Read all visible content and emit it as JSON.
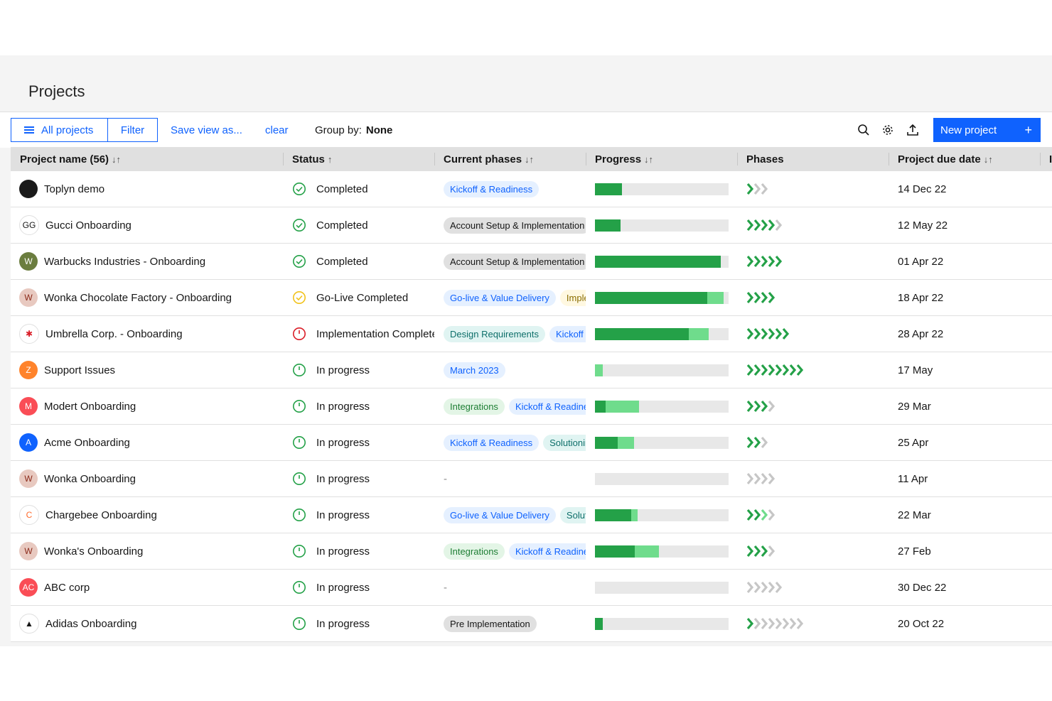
{
  "page": {
    "title": "Projects"
  },
  "toolbar": {
    "all_projects": "All projects",
    "filter": "Filter",
    "save_view": "Save view as...",
    "clear": "clear",
    "group_by_label": "Group by:",
    "group_by_value": "None",
    "new_project": "New project",
    "new_project_icon": "+"
  },
  "columns": {
    "name": "Project name (56)",
    "status": "Status",
    "current_phases": "Current phases",
    "progress": "Progress",
    "phases": "Phases",
    "due": "Project due date",
    "extra": "I",
    "sort_both": "↓↑",
    "sort_up": "↑"
  },
  "colors": {
    "accent": "#0f62fe",
    "progress_done": "#24a148",
    "progress_active": "#6fdc8c",
    "chevron_done": "#24a148",
    "chevron_active": "#6fdc8c",
    "chevron_todo": "#c6c6c6"
  },
  "rows": [
    {
      "name": "Toplyn demo",
      "avatar": {
        "icon": "toplyn-logo",
        "text": "",
        "bg": "#1a1a1a"
      },
      "status": "Completed",
      "status_icon": "check-circle-icon",
      "status_color": "#24a148",
      "tags": [
        {
          "label": "Kickoff & Readiness",
          "style": "blue"
        }
      ],
      "progress_done": 0.2,
      "progress_active": 0,
      "phases": {
        "done": 1,
        "active": 0,
        "todo": 2
      },
      "due": "14 Dec 22"
    },
    {
      "name": "Gucci Onboarding",
      "avatar": {
        "icon": "gucci-logo",
        "text": "GG",
        "bg": "#ffffff",
        "fg": "#161616"
      },
      "status": "Completed",
      "status_icon": "check-circle-icon",
      "status_color": "#24a148",
      "tags": [
        {
          "label": "Account Setup & Implementation",
          "style": "gray"
        }
      ],
      "progress_done": 0.19,
      "progress_active": 0,
      "phases": {
        "done": 4,
        "active": 0,
        "todo": 1
      },
      "due": "12 May 22"
    },
    {
      "name": "Warbucks Industries - Onboarding",
      "avatar": {
        "icon": "warbucks-logo",
        "text": "W",
        "bg": "#6b7d3f"
      },
      "status": "Completed",
      "status_icon": "check-circle-icon",
      "status_color": "#24a148",
      "tags": [
        {
          "label": "Account Setup & Implementation",
          "style": "gray"
        }
      ],
      "progress_done": 0.94,
      "progress_active": 0,
      "phases": {
        "done": 5,
        "active": 0,
        "todo": 0
      },
      "due": "01 Apr 22"
    },
    {
      "name": "Wonka Chocolate Factory - Onboarding",
      "avatar": {
        "icon": "wonka-logo",
        "text": "W",
        "bg": "#e8c9c0",
        "fg": "#8b2a1a"
      },
      "status": "Go-Live Completed",
      "status_icon": "golive-circle-icon",
      "status_color": "#f1c21b",
      "tags": [
        {
          "label": "Go-live & Value Delivery",
          "style": "blue"
        },
        {
          "label": "Implementation",
          "style": "yellow"
        }
      ],
      "progress_done": 0.84,
      "progress_active": 0.12,
      "phases": {
        "done": 4,
        "active": 0,
        "todo": 0
      },
      "due": "18 Apr 22"
    },
    {
      "name": "Umbrella Corp. - Onboarding",
      "avatar": {
        "icon": "umbrella-logo",
        "text": "✱",
        "bg": "#ffffff",
        "fg": "#da1e28"
      },
      "status": "Implementation Completed",
      "status_icon": "overdue-clock-icon",
      "status_color": "#da1e28",
      "tags": [
        {
          "label": "Design Requirements",
          "style": "teal"
        },
        {
          "label": "Kickoff & Readiness",
          "style": "blue"
        }
      ],
      "progress_done": 0.7,
      "progress_active": 0.15,
      "phases": {
        "done": 6,
        "active": 0,
        "todo": 0
      },
      "due": "28 Apr 22"
    },
    {
      "name": "Support Issues",
      "avatar": {
        "icon": "zendesk-logo",
        "text": "Z",
        "bg": "#ff832b"
      },
      "status": "In progress",
      "status_icon": "progress-clock-icon",
      "status_color": "#24a148",
      "tags": [
        {
          "label": "March 2023",
          "style": "blue"
        }
      ],
      "progress_done": 0,
      "progress_active": 0.06,
      "phases": {
        "done": 8,
        "active": 0,
        "todo": 0
      },
      "due": "17 May"
    },
    {
      "name": "Modert Onboarding",
      "avatar": {
        "icon": "modert-logo",
        "text": "M",
        "bg": "#fa4d56"
      },
      "status": "In progress",
      "status_icon": "progress-clock-icon",
      "status_color": "#24a148",
      "tags": [
        {
          "label": "Integrations",
          "style": "green"
        },
        {
          "label": "Kickoff & Readiness",
          "style": "blue"
        }
      ],
      "progress_done": 0.08,
      "progress_active": 0.25,
      "phases": {
        "done": 3,
        "active": 0,
        "todo": 1
      },
      "due": "29 Mar"
    },
    {
      "name": "Acme Onboarding",
      "avatar": {
        "icon": "acme-logo",
        "text": "A",
        "bg": "#0f62fe"
      },
      "status": "In progress",
      "status_icon": "progress-clock-icon",
      "status_color": "#24a148",
      "tags": [
        {
          "label": "Kickoff & Readiness",
          "style": "blue"
        },
        {
          "label": "Solutioning",
          "style": "teal"
        }
      ],
      "progress_done": 0.17,
      "progress_active": 0.12,
      "phases": {
        "done": 2,
        "active": 0,
        "todo": 1
      },
      "due": "25 Apr"
    },
    {
      "name": "Wonka Onboarding",
      "avatar": {
        "icon": "wonka-logo",
        "text": "W",
        "bg": "#e8c9c0",
        "fg": "#8b2a1a"
      },
      "status": "In progress",
      "status_icon": "progress-clock-icon",
      "status_color": "#24a148",
      "tags": [],
      "tag_empty": "-",
      "progress_done": 0,
      "progress_active": 0,
      "phases": {
        "done": 0,
        "active": 0,
        "todo": 4
      },
      "due": "11 Apr"
    },
    {
      "name": "Chargebee Onboarding",
      "avatar": {
        "icon": "chargebee-logo",
        "text": "C",
        "bg": "#ffffff",
        "fg": "#ff6a2c"
      },
      "status": "In progress",
      "status_icon": "progress-clock-icon",
      "status_color": "#24a148",
      "tags": [
        {
          "label": "Go-live & Value Delivery",
          "style": "blue"
        },
        {
          "label": "Solutioning",
          "style": "teal"
        }
      ],
      "progress_done": 0.27,
      "progress_active": 0.05,
      "phases": {
        "done": 2,
        "active": 1,
        "todo": 1
      },
      "due": "22 Mar"
    },
    {
      "name": "Wonka's Onboarding",
      "avatar": {
        "icon": "wonka-logo",
        "text": "W",
        "bg": "#e8c9c0",
        "fg": "#8b2a1a"
      },
      "status": "In progress",
      "status_icon": "progress-clock-icon",
      "status_color": "#24a148",
      "tags": [
        {
          "label": "Integrations",
          "style": "green"
        },
        {
          "label": "Kickoff & Readiness",
          "style": "blue"
        }
      ],
      "progress_done": 0.3,
      "progress_active": 0.18,
      "phases": {
        "done": 3,
        "active": 0,
        "todo": 1
      },
      "due": "27 Feb"
    },
    {
      "name": "ABC corp",
      "avatar": {
        "icon": "abc-logo",
        "text": "AC",
        "bg": "#fa4d56"
      },
      "status": "In progress",
      "status_icon": "progress-clock-icon",
      "status_color": "#24a148",
      "tags": [],
      "tag_empty": "-",
      "progress_done": 0,
      "progress_active": 0,
      "phases": {
        "done": 0,
        "active": 0,
        "todo": 5
      },
      "due": "30 Dec 22"
    },
    {
      "name": "Adidas Onboarding",
      "avatar": {
        "icon": "adidas-logo",
        "text": "▲",
        "bg": "#ffffff",
        "fg": "#161616"
      },
      "status": "In progress",
      "status_icon": "progress-clock-icon",
      "status_color": "#24a148",
      "tags": [
        {
          "label": "Pre Implementation",
          "style": "gray"
        }
      ],
      "progress_done": 0.06,
      "progress_active": 0,
      "phases": {
        "done": 1,
        "active": 0,
        "todo": 7
      },
      "due": "20 Oct 22"
    }
  ]
}
